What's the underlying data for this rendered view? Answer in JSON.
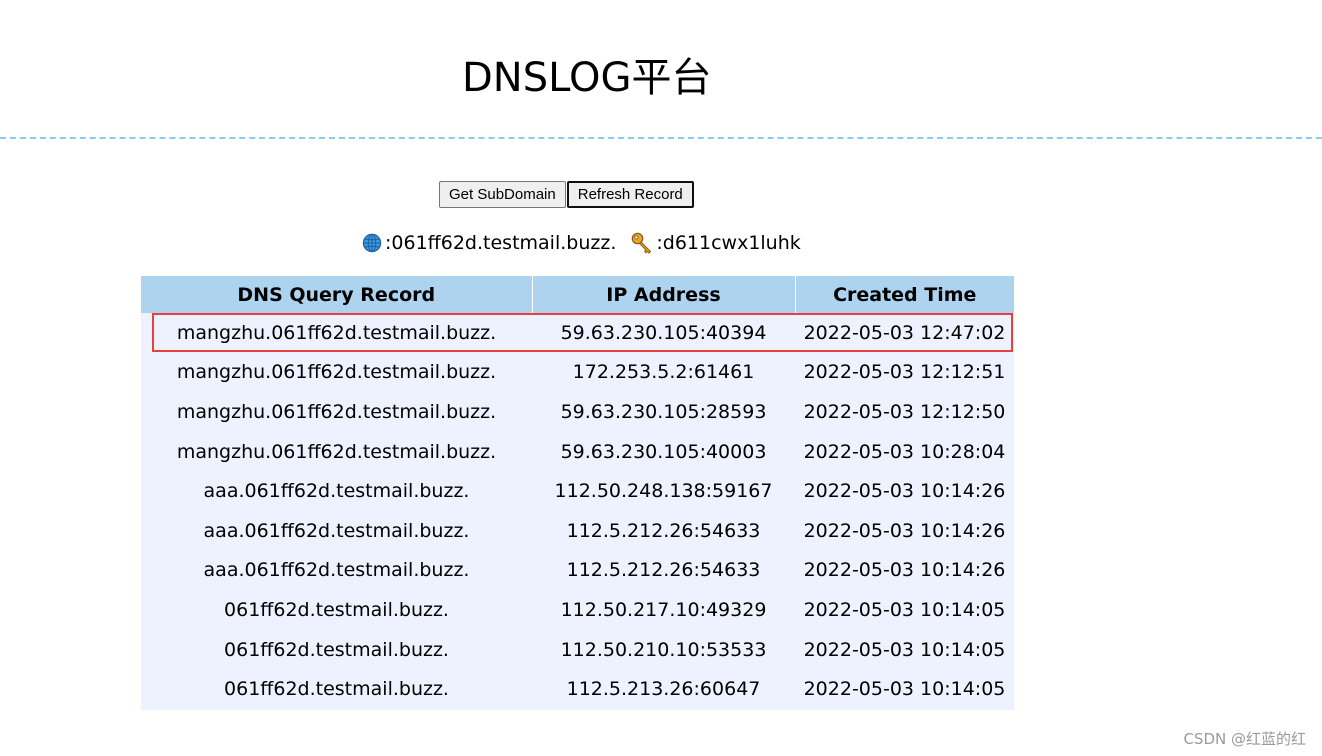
{
  "page": {
    "title": "DNSLOG平台"
  },
  "buttons": {
    "get_subdomain": "Get SubDomain",
    "refresh_record": "Refresh Record"
  },
  "info": {
    "domain": ":061ff62d.testmail.buzz.",
    "token": ":d611cwx1luhk"
  },
  "table": {
    "headers": [
      "DNS Query Record",
      "IP Address",
      "Created Time"
    ],
    "rows": [
      [
        "mangzhu.061ff62d.testmail.buzz.",
        "59.63.230.105:40394",
        "2022-05-03 12:47:02"
      ],
      [
        "mangzhu.061ff62d.testmail.buzz.",
        "172.253.5.2:61461",
        "2022-05-03 12:12:51"
      ],
      [
        "mangzhu.061ff62d.testmail.buzz.",
        "59.63.230.105:28593",
        "2022-05-03 12:12:50"
      ],
      [
        "mangzhu.061ff62d.testmail.buzz.",
        "59.63.230.105:40003",
        "2022-05-03 10:28:04"
      ],
      [
        "aaa.061ff62d.testmail.buzz.",
        "112.50.248.138:59167",
        "2022-05-03 10:14:26"
      ],
      [
        "aaa.061ff62d.testmail.buzz.",
        "112.5.212.26:54633",
        "2022-05-03 10:14:26"
      ],
      [
        "aaa.061ff62d.testmail.buzz.",
        "112.5.212.26:54633",
        "2022-05-03 10:14:26"
      ],
      [
        "061ff62d.testmail.buzz.",
        "112.50.217.10:49329",
        "2022-05-03 10:14:05"
      ],
      [
        "061ff62d.testmail.buzz.",
        "112.50.210.10:53533",
        "2022-05-03 10:14:05"
      ],
      [
        "061ff62d.testmail.buzz.",
        "112.5.213.26:60647",
        "2022-05-03 10:14:05"
      ]
    ]
  },
  "watermark": "CSDN @红蓝的红",
  "colors": {
    "header_bg": "#aed3ef",
    "table_bg": "#eef2ff",
    "divider": "#87ceeb",
    "highlight": "#e8413c"
  },
  "icons": {
    "domain": "globe-icon",
    "token": "key-icon"
  }
}
